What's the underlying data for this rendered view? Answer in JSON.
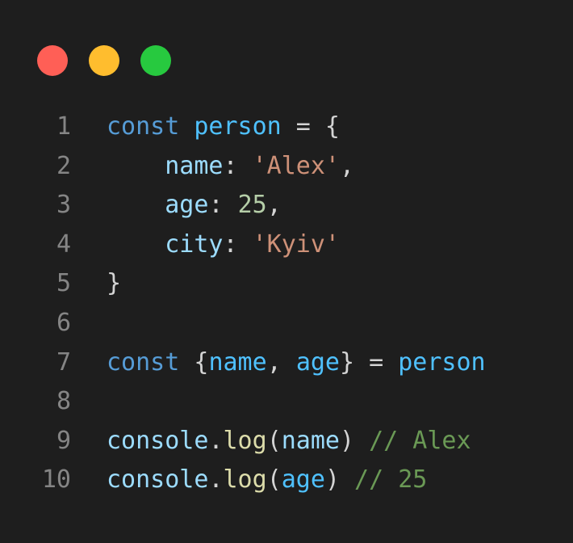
{
  "window": {
    "traffic_lights": [
      {
        "name": "close",
        "color": "#ff5f56"
      },
      {
        "name": "minimize",
        "color": "#ffbd2e"
      },
      {
        "name": "maximize",
        "color": "#27c93f"
      }
    ]
  },
  "colors": {
    "background": "#1e1e1e",
    "line_number": "#858585",
    "keyword": "#569cd6",
    "variable": "#4fc1ff",
    "property": "#9cdcfe",
    "string": "#ce9178",
    "number": "#b5cea8",
    "function": "#dcdcaa",
    "comment": "#6a9955",
    "punctuation": "#d4d4d4"
  },
  "code": [
    {
      "n": "1",
      "tokens": [
        {
          "t": "const",
          "c": "keyword"
        },
        {
          "t": " ",
          "c": "punctuation"
        },
        {
          "t": "person",
          "c": "variable"
        },
        {
          "t": " = {",
          "c": "punctuation"
        }
      ]
    },
    {
      "n": "2",
      "tokens": [
        {
          "t": "    ",
          "c": "punctuation"
        },
        {
          "t": "name",
          "c": "property"
        },
        {
          "t": ": ",
          "c": "punctuation"
        },
        {
          "t": "'Alex'",
          "c": "string"
        },
        {
          "t": ",",
          "c": "punctuation"
        }
      ]
    },
    {
      "n": "3",
      "tokens": [
        {
          "t": "    ",
          "c": "punctuation"
        },
        {
          "t": "age",
          "c": "property"
        },
        {
          "t": ": ",
          "c": "punctuation"
        },
        {
          "t": "25",
          "c": "number"
        },
        {
          "t": ",",
          "c": "punctuation"
        }
      ]
    },
    {
      "n": "4",
      "tokens": [
        {
          "t": "    ",
          "c": "punctuation"
        },
        {
          "t": "city",
          "c": "property"
        },
        {
          "t": ": ",
          "c": "punctuation"
        },
        {
          "t": "'Kyiv'",
          "c": "string"
        }
      ]
    },
    {
      "n": "5",
      "tokens": [
        {
          "t": "}",
          "c": "punctuation"
        }
      ]
    },
    {
      "n": "6",
      "tokens": []
    },
    {
      "n": "7",
      "tokens": [
        {
          "t": "const",
          "c": "keyword"
        },
        {
          "t": " {",
          "c": "punctuation"
        },
        {
          "t": "name",
          "c": "variable"
        },
        {
          "t": ", ",
          "c": "punctuation"
        },
        {
          "t": "age",
          "c": "variable"
        },
        {
          "t": "} = ",
          "c": "punctuation"
        },
        {
          "t": "person",
          "c": "variable"
        }
      ]
    },
    {
      "n": "8",
      "tokens": []
    },
    {
      "n": "9",
      "tokens": [
        {
          "t": "console",
          "c": "property"
        },
        {
          "t": ".",
          "c": "punctuation"
        },
        {
          "t": "log",
          "c": "function"
        },
        {
          "t": "(",
          "c": "punctuation"
        },
        {
          "t": "name",
          "c": "property"
        },
        {
          "t": ")",
          "c": "punctuation"
        },
        {
          "t": " // Alex",
          "c": "comment"
        }
      ]
    },
    {
      "n": "10",
      "tokens": [
        {
          "t": "console",
          "c": "property"
        },
        {
          "t": ".",
          "c": "punctuation"
        },
        {
          "t": "log",
          "c": "function"
        },
        {
          "t": "(",
          "c": "punctuation"
        },
        {
          "t": "age",
          "c": "variable"
        },
        {
          "t": ")",
          "c": "punctuation"
        },
        {
          "t": " // 25",
          "c": "comment"
        }
      ]
    }
  ]
}
